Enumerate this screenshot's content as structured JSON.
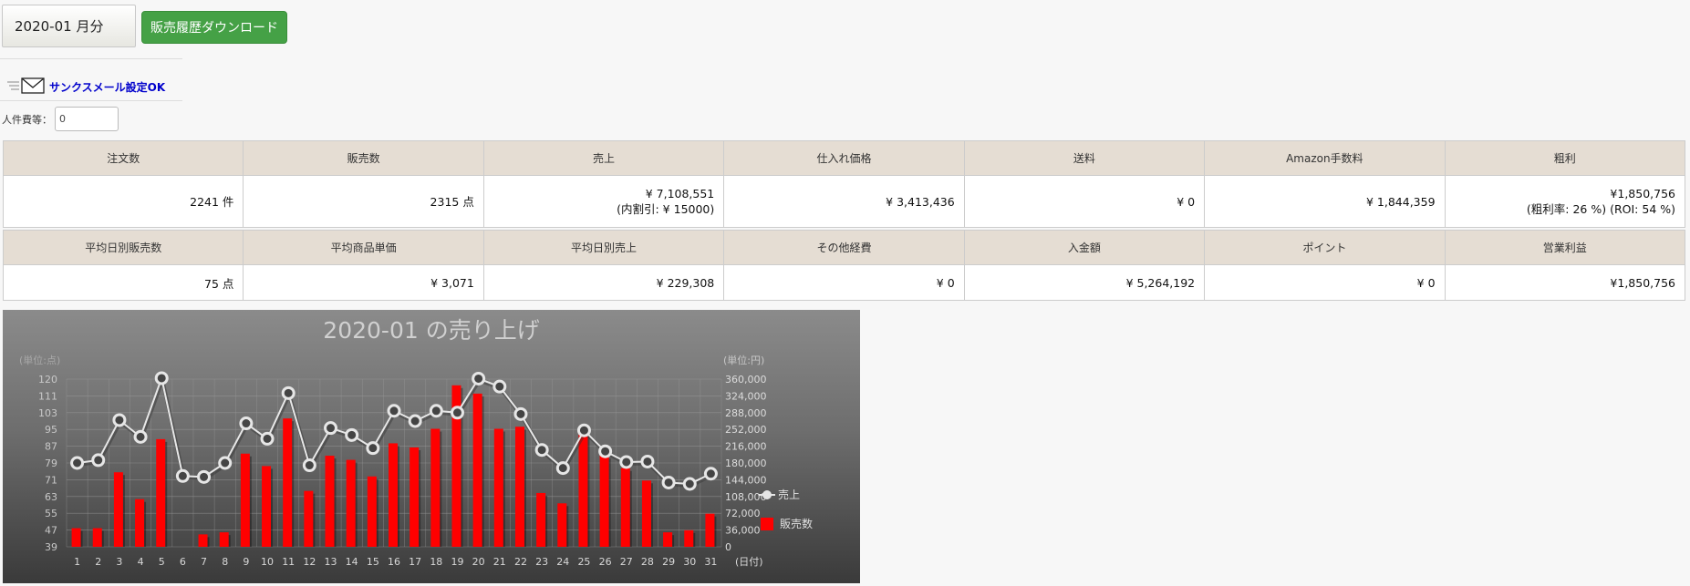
{
  "month_select": {
    "value": "2020-01 月分"
  },
  "download_button": {
    "label": "販売履歴ダウンロード"
  },
  "thanks_mail": {
    "label": "サンクスメール設定OK"
  },
  "staff_cost": {
    "label": "人件費等：",
    "value": "0"
  },
  "table1": {
    "headers": [
      "注文数",
      "販売数",
      "売上",
      "仕入れ価格",
      "送料",
      "Amazon手数料",
      "粗利"
    ],
    "cells": [
      {
        "line1": "2241 件",
        "line2": ""
      },
      {
        "line1": "2315 点",
        "line2": ""
      },
      {
        "line1": "¥ 7,108,551",
        "line2": "(内割引: ¥ 15000)"
      },
      {
        "line1": "¥ 3,413,436",
        "line2": ""
      },
      {
        "line1": "¥ 0",
        "line2": ""
      },
      {
        "line1": "¥ 1,844,359",
        "line2": ""
      },
      {
        "line1": "¥1,850,756",
        "line2": "(粗利率: 26 %) (ROI: 54 %)"
      }
    ]
  },
  "table2": {
    "headers": [
      "平均日別販売数",
      "平均商品単価",
      "平均日別売上",
      "その他経費",
      "入金額",
      "ポイント",
      "営業利益"
    ],
    "cells": [
      "75 点",
      "¥ 3,071",
      "¥ 229,308",
      "¥ 0",
      "¥ 5,264,192",
      "¥ 0",
      "¥1,850,756"
    ]
  },
  "chart_data": {
    "type": "bar+line",
    "title": "2020-01 の売り上げ",
    "y_left_label": "(単位:点)",
    "y_right_label": "(単位:円)",
    "x_label": "(日付)",
    "categories": [
      "1",
      "2",
      "3",
      "4",
      "5",
      "6",
      "7",
      "8",
      "9",
      "10",
      "11",
      "12",
      "13",
      "14",
      "15",
      "16",
      "17",
      "18",
      "19",
      "20",
      "21",
      "22",
      "23",
      "24",
      "25",
      "26",
      "27",
      "28",
      "29",
      "30",
      "31"
    ],
    "y_left_ticks": [
      "39",
      "47",
      "55",
      "63",
      "71",
      "79",
      "87",
      "95",
      "103",
      "111",
      "120"
    ],
    "y_left_range": [
      39,
      120
    ],
    "y_right_ticks": [
      "0",
      "36,000",
      "72,000",
      "108,000",
      "144,000",
      "180,000",
      "216,000",
      "252,000",
      "288,000",
      "324,000",
      "360,000"
    ],
    "y_right_range": [
      0,
      360000
    ],
    "series": [
      {
        "name": "販売数",
        "type": "bar",
        "color": "#ff0000",
        "values": [
          48,
          48,
          75,
          62,
          91,
          39,
          45,
          46,
          84,
          78,
          101,
          66,
          83,
          81,
          73,
          89,
          87,
          96,
          117,
          113,
          96,
          97,
          65,
          60,
          96,
          83,
          77,
          71,
          46,
          47,
          55
        ]
      },
      {
        "name": "売上",
        "type": "line",
        "color": "#e8e8e8",
        "values": [
          180000,
          186000,
          272000,
          236000,
          362000,
          152000,
          150000,
          180000,
          265000,
          232000,
          330000,
          175000,
          255000,
          240000,
          212000,
          292000,
          270000,
          292000,
          288000,
          361000,
          344000,
          285000,
          208000,
          169000,
          250000,
          205000,
          182000,
          183000,
          138000,
          135000,
          157000
        ]
      }
    ]
  }
}
